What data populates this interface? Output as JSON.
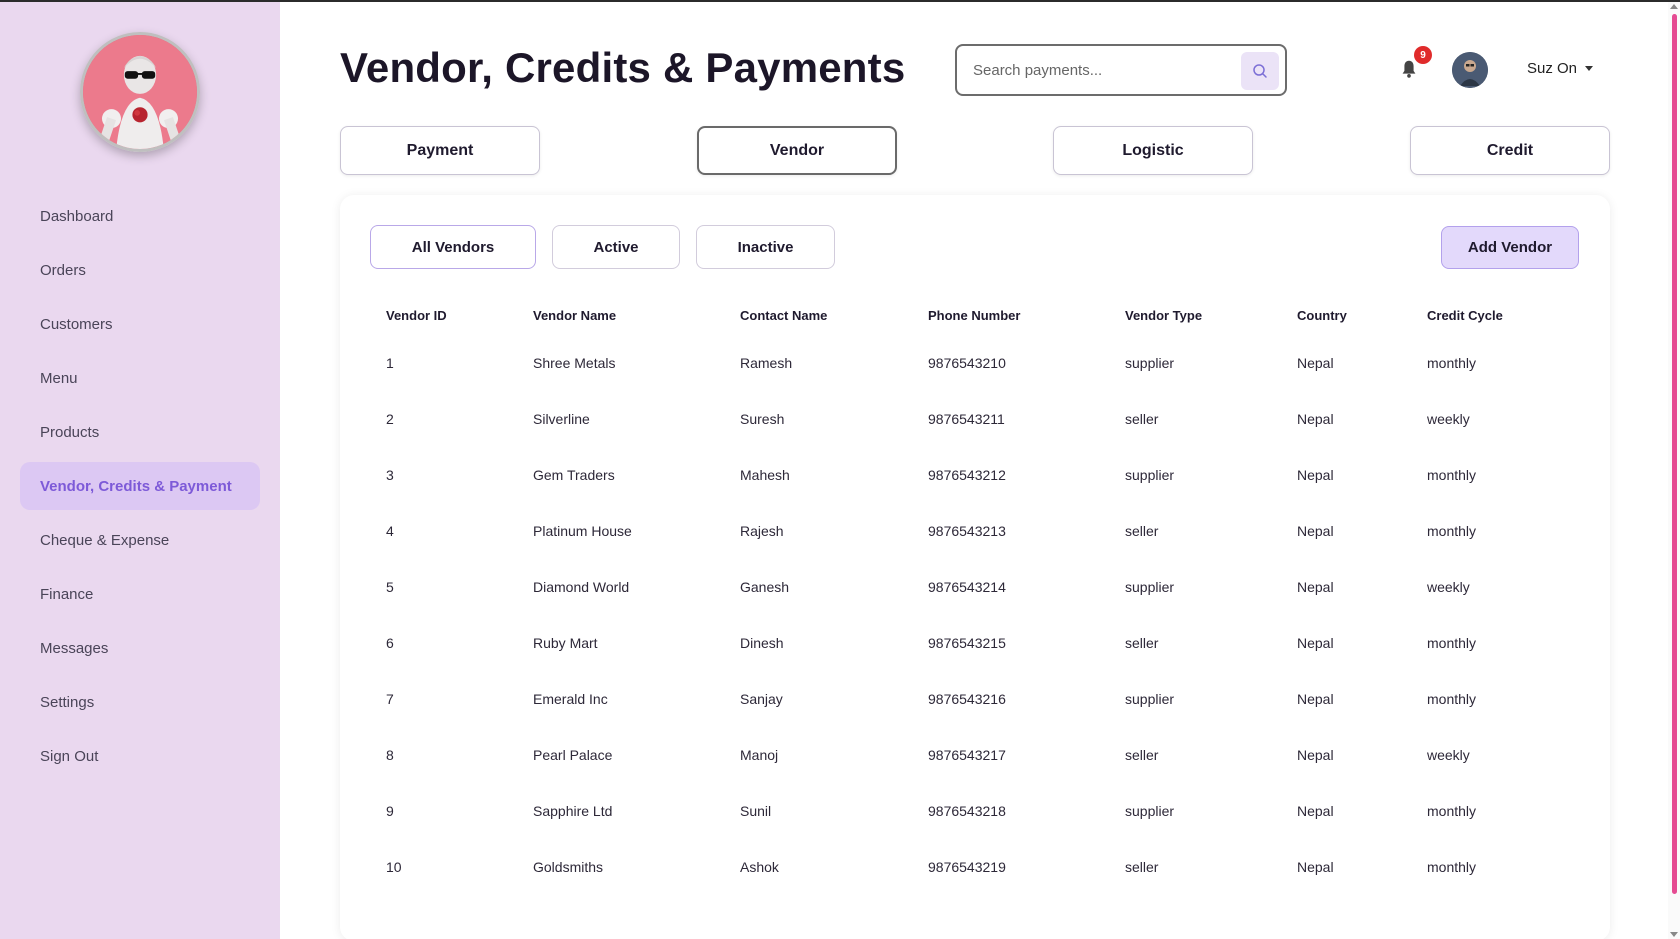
{
  "header": {
    "title": "Vendor, Credits & Payments",
    "search_placeholder": "Search payments...",
    "notification_count": "9",
    "user_name": "Suz On"
  },
  "sidebar": {
    "items": [
      {
        "label": "Dashboard"
      },
      {
        "label": "Orders"
      },
      {
        "label": "Customers"
      },
      {
        "label": "Menu"
      },
      {
        "label": "Products"
      },
      {
        "label": "Vendor, Credits & Payment",
        "active": true
      },
      {
        "label": "Cheque & Expense"
      },
      {
        "label": "Finance"
      },
      {
        "label": "Messages"
      },
      {
        "label": "Settings"
      },
      {
        "label": "Sign Out"
      }
    ]
  },
  "tabs": [
    {
      "label": "Payment"
    },
    {
      "label": "Vendor",
      "active": true
    },
    {
      "label": "Logistic"
    },
    {
      "label": "Credit"
    }
  ],
  "filters": [
    {
      "label": "All Vendors",
      "active": true
    },
    {
      "label": "Active"
    },
    {
      "label": "Inactive"
    }
  ],
  "add_vendor_label": "Add Vendor",
  "table": {
    "columns": [
      "Vendor ID",
      "Vendor Name",
      "Contact Name",
      "Phone Number",
      "Vendor Type",
      "Country",
      "Credit Cycle"
    ],
    "rows": [
      [
        "1",
        "Shree Metals",
        "Ramesh",
        "9876543210",
        "supplier",
        "Nepal",
        "monthly"
      ],
      [
        "2",
        "Silverline",
        "Suresh",
        "9876543211",
        "seller",
        "Nepal",
        "weekly"
      ],
      [
        "3",
        "Gem Traders",
        "Mahesh",
        "9876543212",
        "supplier",
        "Nepal",
        "monthly"
      ],
      [
        "4",
        "Platinum House",
        "Rajesh",
        "9876543213",
        "seller",
        "Nepal",
        "monthly"
      ],
      [
        "5",
        "Diamond World",
        "Ganesh",
        "9876543214",
        "supplier",
        "Nepal",
        "weekly"
      ],
      [
        "6",
        "Ruby Mart",
        "Dinesh",
        "9876543215",
        "seller",
        "Nepal",
        "monthly"
      ],
      [
        "7",
        "Emerald Inc",
        "Sanjay",
        "9876543216",
        "supplier",
        "Nepal",
        "monthly"
      ],
      [
        "8",
        "Pearl Palace",
        "Manoj",
        "9876543217",
        "seller",
        "Nepal",
        "weekly"
      ],
      [
        "9",
        "Sapphire Ltd",
        "Sunil",
        "9876543218",
        "supplier",
        "Nepal",
        "monthly"
      ],
      [
        "10",
        "Goldsmiths",
        "Ashok",
        "9876543219",
        "seller",
        "Nepal",
        "monthly"
      ]
    ]
  },
  "colors": {
    "sidebar_bg": "#ead8ef",
    "active_nav_bg": "#dcc8f3",
    "active_nav_text": "#7d5ad8",
    "accent_button": "#e3d9fb",
    "notification_badge": "#e02b2b",
    "scrollbar_thumb": "#e54b92"
  },
  "icons": {
    "search": "search-icon",
    "notification": "bell-icon",
    "dropdown": "chevron-down-icon"
  }
}
